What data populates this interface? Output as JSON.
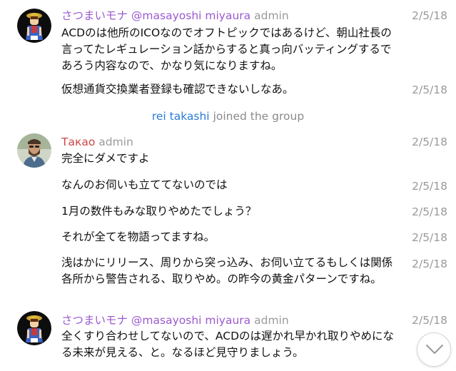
{
  "colors": {
    "name_purple": "#9b59d0",
    "name_red": "#d04545",
    "system_blue": "#2c7bd8",
    "muted": "#9a9a9a"
  },
  "messages": [
    {
      "sender": "さつまいモナ @masayoshi miyaura",
      "role": "admin",
      "time": "2/5/18",
      "text": "ACDのは他所のICOなのでオフトピックではあるけど、朝山社長の言ってたレギュレーション話からすると真っ向バッティングするであろう内容なので、かなり気になりますね。"
    },
    {
      "time": "2/5/18",
      "text": "仮想通貨交換業者登録も確認できないしなあ。"
    },
    {
      "sender": "Такао",
      "role": "admin",
      "time": "2/5/18",
      "text": "完全にダメですよ"
    },
    {
      "time": "2/5/18",
      "text": "なんのお伺いも立ててないのでは"
    },
    {
      "time": "2/5/18",
      "text": "1月の数件もみな取りやめたでしょう？"
    },
    {
      "time": "2/5/18",
      "text": "それが全てを物語ってますね。"
    },
    {
      "time": "2/5/18",
      "text": "浅はかにリリース、周りから突っ込み、お伺い立てるもしくは関係各所から警告される、取りやめ。の昨今の黄金パターンですね。"
    },
    {
      "sender": "さつまいモナ @masayoshi miyaura",
      "role": "admin",
      "time": "2/5/18",
      "text": "全くすり合わせしてないので、ACDのは遅かれ早かれ取りやめになる未来が見える、と。なるほど見守りましょう。"
    }
  ],
  "system": {
    "user": "rei takashi",
    "action": "joined the group"
  },
  "icons": {
    "scroll_down": "chevron-down-icon"
  }
}
